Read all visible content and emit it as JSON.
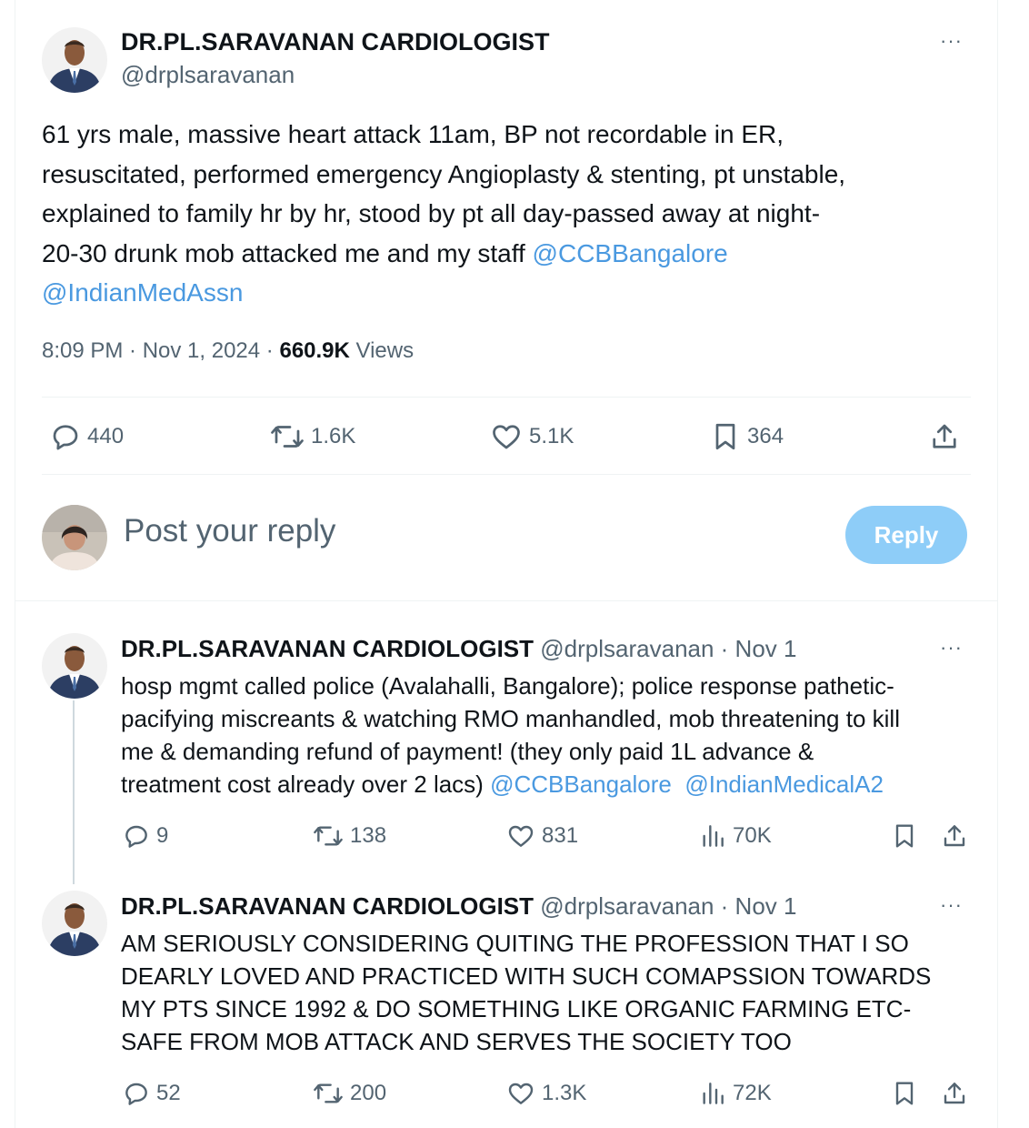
{
  "main_tweet": {
    "author_name": "DR.PL.SARAVANAN CARDIOLOGIST",
    "handle": "@drplsaravanan",
    "more_label": "···",
    "text_lines": [
      "61 yrs male, massive heart attack 11am, BP not recordable in ER,",
      "resuscitated, performed emergency Angioplasty & stenting, pt unstable,",
      "explained to family hr by hr, stood by pt all day-passed away at night-",
      "20-30 drunk mob attacked me and my staff "
    ],
    "mention_1": "@CCBBangalore",
    "mention_2": "@IndianMedAssn",
    "time": "8:09 PM · Nov 1, 2024 · ",
    "views_count": "660.9K",
    "views_label": " Views",
    "replies": "440",
    "reposts": "1.6K",
    "likes": "5.1K",
    "bookmarks": "364"
  },
  "composer": {
    "placeholder": "Post your reply",
    "reply_button": "Reply"
  },
  "replies": [
    {
      "author_name": "DR.PL.SARAVANAN CARDIOLOGIST",
      "handle": "@drplsaravanan",
      "date": " · Nov 1",
      "more_label": "···",
      "text_lines": [
        "hosp mgmt called police (Avalahalli, Bangalore); police response pathetic-",
        "pacifying miscreants & watching RMO manhandled, mob threatening to kill",
        "me & demanding refund of payment! (they only paid 1L advance &",
        "treatment cost already over 2 lacs) "
      ],
      "mention_1": "@CCBBangalore",
      "mention_2": "@IndianMedicalA2",
      "replies": "9",
      "reposts": "138",
      "likes": "831",
      "views": "70K"
    },
    {
      "author_name": "DR.PL.SARAVANAN CARDIOLOGIST",
      "handle": "@drplsaravanan",
      "date": " · Nov 1",
      "more_label": "···",
      "text_lines": [
        "AM SERIOUSLY CONSIDERING QUITING THE PROFESSION THAT I SO",
        "DEARLY LOVED AND PRACTICED WITH SUCH COMAPSSION TOWARDS",
        "MY PTS SINCE 1992 & DO SOMETHING LIKE ORGANIC FARMING ETC-",
        "SAFE FROM MOB ATTACK AND SERVES THE SOCIETY TOO"
      ],
      "replies": "52",
      "reposts": "200",
      "likes": "1.3K",
      "views": "72K"
    }
  ]
}
